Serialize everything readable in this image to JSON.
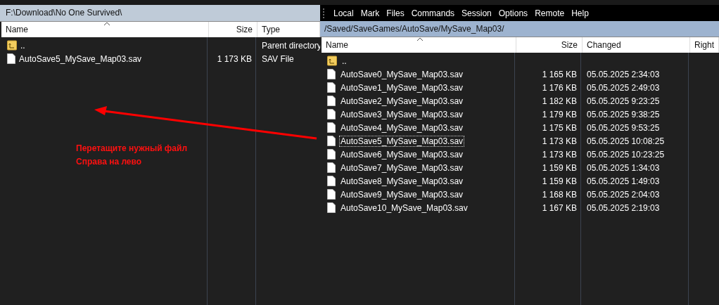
{
  "left_panel": {
    "path": "F:\\Download\\No One Survived\\",
    "columns": [
      {
        "label": "Name"
      },
      {
        "label": "Size"
      },
      {
        "label": "Type"
      }
    ],
    "rows": [
      {
        "kind": "parent",
        "name": "..",
        "size": "",
        "type": "Parent directory"
      },
      {
        "kind": "file",
        "name": "AutoSave5_MySave_Map03.sav",
        "size": "1 173 KB",
        "type": "SAV File"
      }
    ]
  },
  "annotation": {
    "lines": [
      "Перетащите нужный файл",
      "Справа на лево"
    ]
  },
  "right_panel": {
    "menu": [
      "Local",
      "Mark",
      "Files",
      "Commands",
      "Session",
      "Options",
      "Remote",
      "Help"
    ],
    "path": "/Saved/SaveGames/AutoSave/MySave_Map03/",
    "columns": [
      {
        "label": "Name"
      },
      {
        "label": "Size"
      },
      {
        "label": "Changed"
      },
      {
        "label": "Right"
      }
    ],
    "rows": [
      {
        "kind": "parent",
        "name": "..",
        "focused": false
      },
      {
        "kind": "file",
        "name": "AutoSave0_MySave_Map03.sav",
        "size": "1 165 KB",
        "changed": "05.05.2025 2:34:03",
        "focused": false
      },
      {
        "kind": "file",
        "name": "AutoSave1_MySave_Map03.sav",
        "size": "1 176 KB",
        "changed": "05.05.2025 2:49:03",
        "focused": false
      },
      {
        "kind": "file",
        "name": "AutoSave2_MySave_Map03.sav",
        "size": "1 182 KB",
        "changed": "05.05.2025 9:23:25",
        "focused": false
      },
      {
        "kind": "file",
        "name": "AutoSave3_MySave_Map03.sav",
        "size": "1 179 KB",
        "changed": "05.05.2025 9:38:25",
        "focused": false
      },
      {
        "kind": "file",
        "name": "AutoSave4_MySave_Map03.sav",
        "size": "1 175 KB",
        "changed": "05.05.2025 9:53:25",
        "focused": false
      },
      {
        "kind": "file",
        "name": "AutoSave5_MySave_Map03.sav",
        "size": "1 173 KB",
        "changed": "05.05.2025 10:08:25",
        "focused": true
      },
      {
        "kind": "file",
        "name": "AutoSave6_MySave_Map03.sav",
        "size": "1 173 KB",
        "changed": "05.05.2025 10:23:25",
        "focused": false
      },
      {
        "kind": "file",
        "name": "AutoSave7_MySave_Map03.sav",
        "size": "1 159 KB",
        "changed": "05.05.2025 1:34:03",
        "focused": false
      },
      {
        "kind": "file",
        "name": "AutoSave8_MySave_Map03.sav",
        "size": "1 159 KB",
        "changed": "05.05.2025 1:49:03",
        "focused": false
      },
      {
        "kind": "file",
        "name": "AutoSave9_MySave_Map03.sav",
        "size": "1 168 KB",
        "changed": "05.05.2025 2:04:03",
        "focused": false
      },
      {
        "kind": "file",
        "name": "AutoSave10_MySave_Map03.sav",
        "size": "1 167 KB",
        "changed": "05.05.2025 2:19:03",
        "focused": false
      }
    ]
  }
}
